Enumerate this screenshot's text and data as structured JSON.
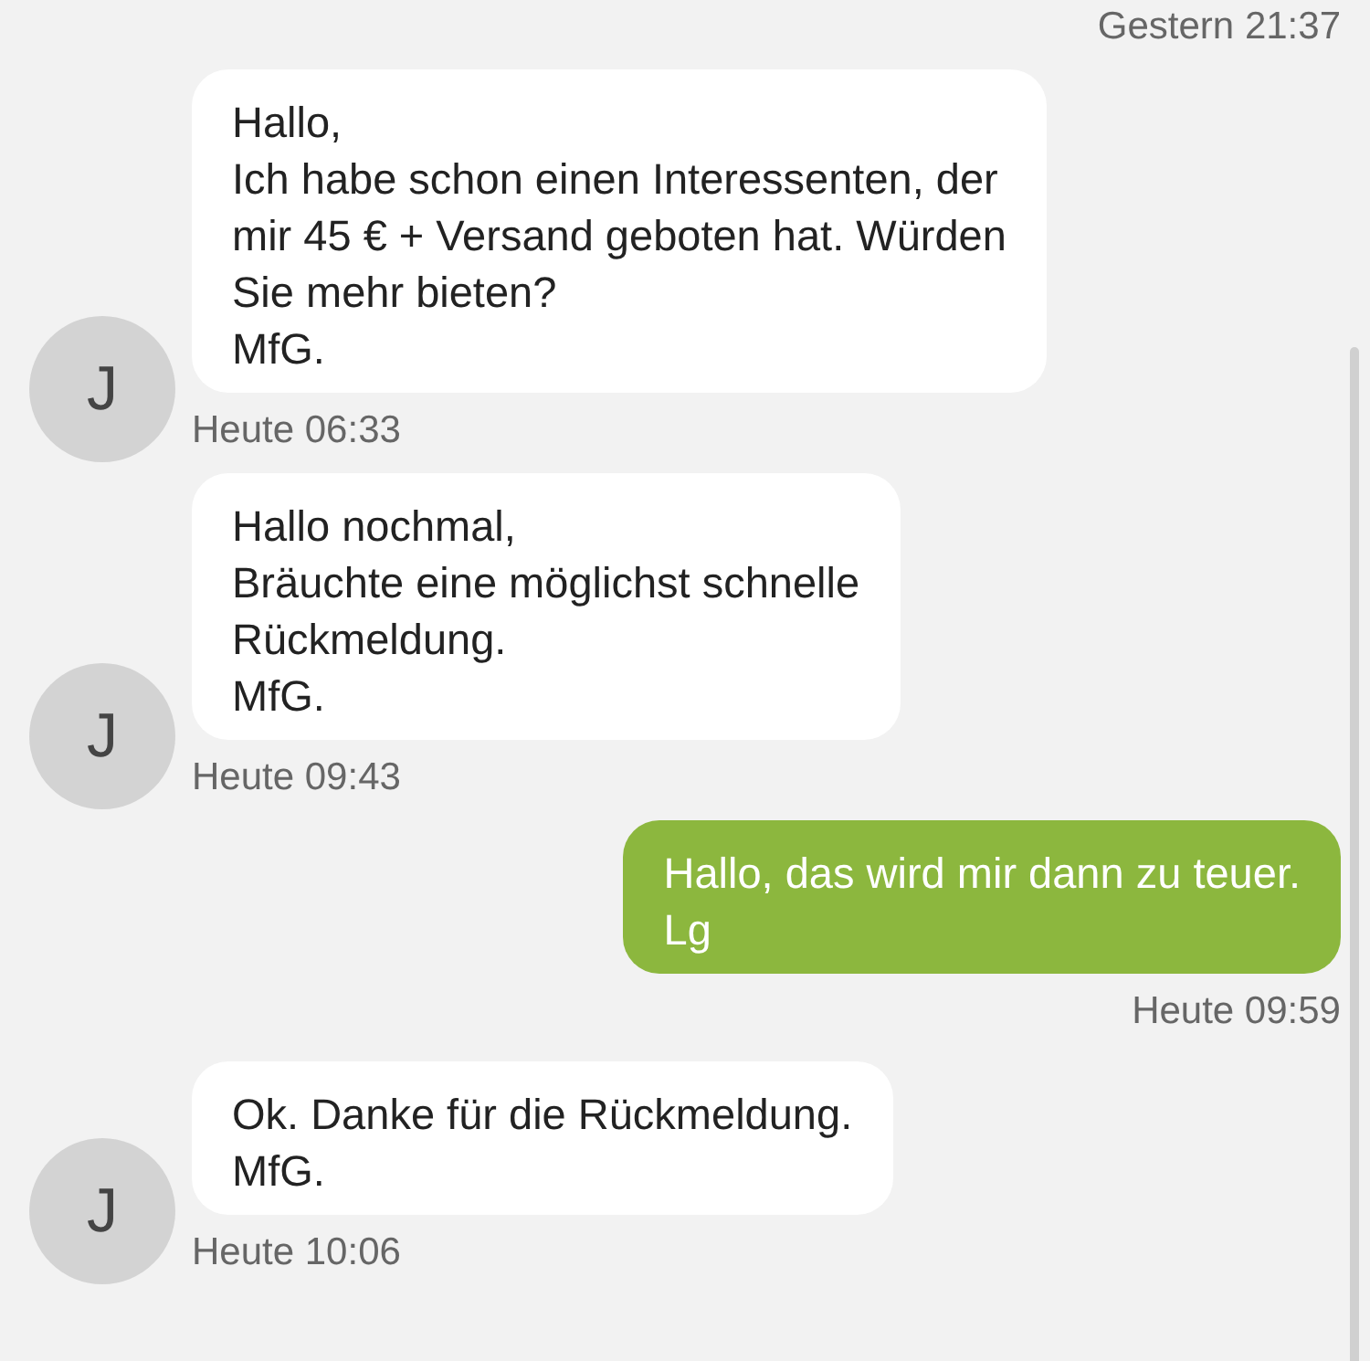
{
  "messages": [
    {
      "kind": "time_only",
      "time": "Gestern 21:37"
    },
    {
      "kind": "incoming",
      "avatar": "J",
      "text": "Hallo,\nIch habe schon einen Interessenten, der\nmir 45 € + Versand geboten hat. Würden\nSie mehr bieten?\nMfG.",
      "time": "Heute 06:33"
    },
    {
      "kind": "incoming",
      "avatar": "J",
      "text": "Hallo nochmal,\nBräuchte eine möglichst schnelle\nRückmeldung.\nMfG.",
      "time": "Heute 09:43"
    },
    {
      "kind": "outgoing",
      "text": "Hallo, das wird mir dann zu teuer.\nLg",
      "time": "Heute 09:59"
    },
    {
      "kind": "incoming",
      "avatar": "J",
      "text": "Ok. Danke für die Rückmeldung.\nMfG.",
      "time": "Heute 10:06"
    }
  ]
}
